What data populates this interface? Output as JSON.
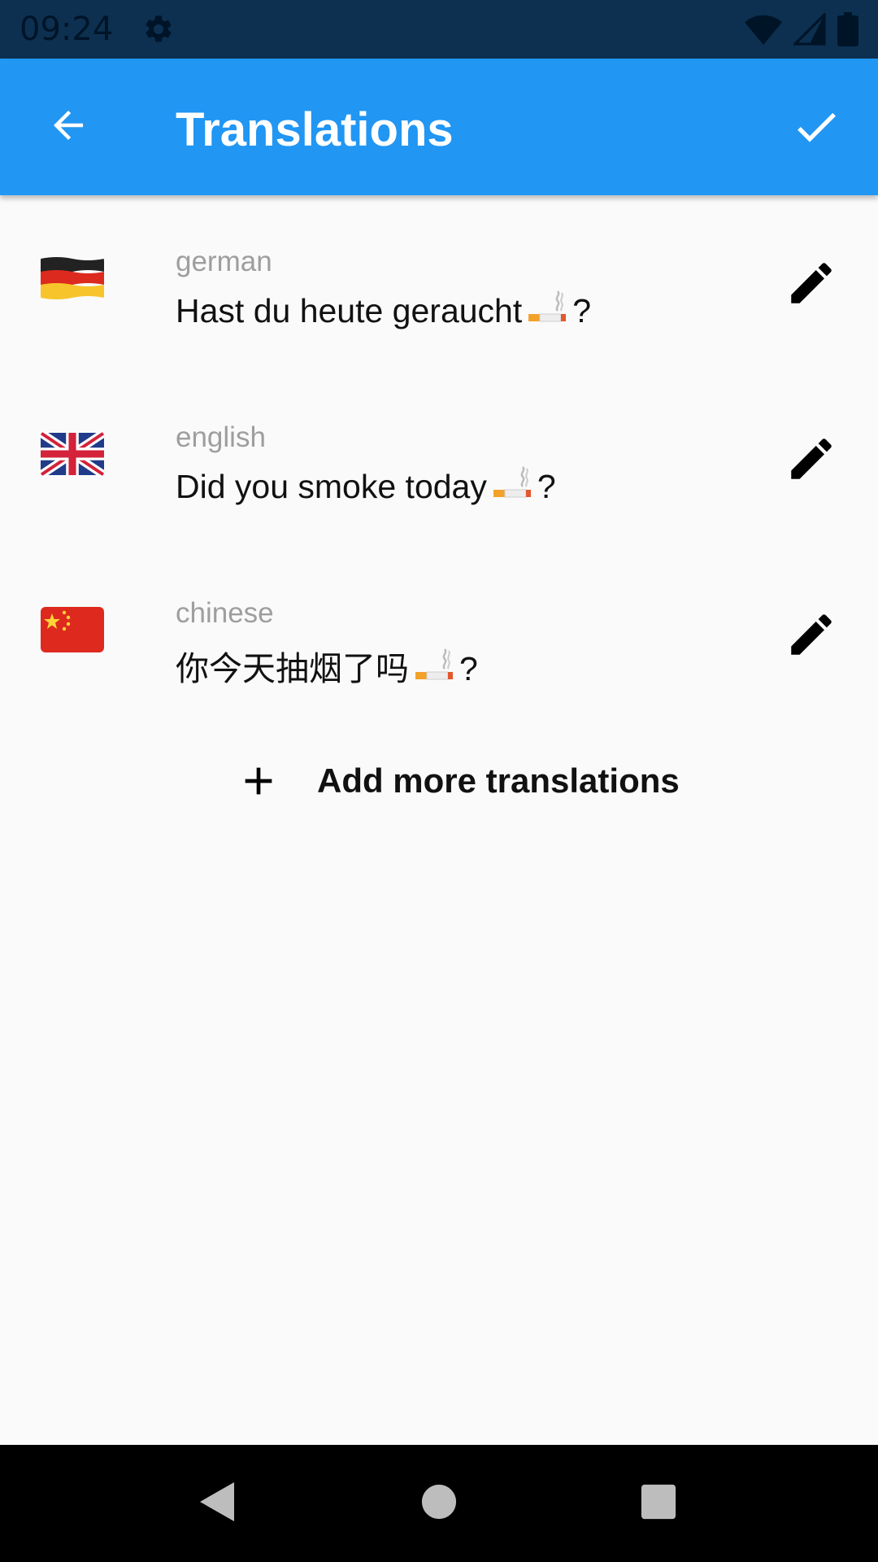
{
  "status_bar": {
    "time": "09:24",
    "icons": [
      "gear-icon",
      "wifi-icon",
      "signal-icon",
      "battery-icon"
    ]
  },
  "app_bar": {
    "title": "Translations",
    "back_icon": "arrow-left-icon",
    "confirm_icon": "check-icon",
    "background": "#2196f3"
  },
  "translations": [
    {
      "language": "german",
      "text_before": "Hast du heute geraucht",
      "text_after": "?",
      "flag": "germany-flag-icon"
    },
    {
      "language": "english",
      "text_before": "Did you smoke today",
      "text_after": "?",
      "flag": "uk-flag-icon"
    },
    {
      "language": "chinese",
      "text_before": "你今天抽烟了吗",
      "text_after": "?",
      "flag": "china-flag-icon"
    }
  ],
  "add_more": {
    "label": "Add more translations",
    "icon": "plus-icon"
  },
  "nav_bar": {
    "icons": [
      "back-triangle-icon",
      "home-circle-icon",
      "recents-square-icon"
    ]
  }
}
